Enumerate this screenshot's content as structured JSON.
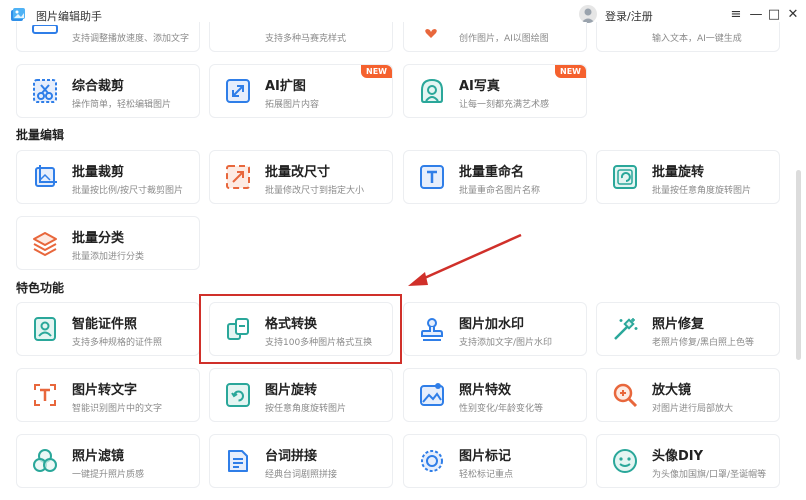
{
  "titlebar": {
    "app_title": "图片编辑助手",
    "login_label": "登录/注册",
    "menu_glyph": "≡",
    "min_glyph": "—",
    "max_glyph": "□",
    "close_glyph": "✕"
  },
  "cards_top": [
    {
      "desc": "支持调整播放速度、添加文字"
    },
    {
      "desc": "支持多种马赛克样式"
    },
    {
      "desc": "创作图片，AI以图绘图"
    },
    {
      "desc": "输入文本，AI一键生成"
    }
  ],
  "cards_row2": [
    {
      "title": "综合裁剪",
      "desc": "操作简单，轻松编辑图片",
      "icon": "crop-icon"
    },
    {
      "title": "AI扩图",
      "desc": "拓展图片内容",
      "icon": "expand-icon",
      "badge": "NEW"
    },
    {
      "title": "AI写真",
      "desc": "让每一刻都充满艺术感",
      "icon": "portrait-icon",
      "badge": "NEW"
    }
  ],
  "sections": {
    "batch": "批量编辑",
    "features": "特色功能"
  },
  "batch_cards": [
    {
      "title": "批量裁剪",
      "desc": "批量按比例/按尺寸裁剪图片",
      "icon": "batch-crop-icon"
    },
    {
      "title": "批量改尺寸",
      "desc": "批量修改尺寸到指定大小",
      "icon": "batch-resize-icon"
    },
    {
      "title": "批量重命名",
      "desc": "批量重命名图片名称",
      "icon": "batch-rename-icon"
    },
    {
      "title": "批量旋转",
      "desc": "批量按任意角度旋转图片",
      "icon": "batch-rotate-icon"
    },
    {
      "title": "批量分类",
      "desc": "批量添加进行分类",
      "icon": "layers-icon"
    }
  ],
  "feature_cards": [
    {
      "title": "智能证件照",
      "desc": "支持多种规格的证件照",
      "icon": "id-photo-icon"
    },
    {
      "title": "格式转换",
      "desc": "支持100多种图片格式互换",
      "icon": "format-convert-icon"
    },
    {
      "title": "图片加水印",
      "desc": "支持添加文字/图片水印",
      "icon": "stamp-icon"
    },
    {
      "title": "照片修复",
      "desc": "老照片修复/黑白照上色等",
      "icon": "magic-wand-icon"
    },
    {
      "title": "图片转文字",
      "desc": "智能识别图片中的文字",
      "icon": "text-recognition-icon"
    },
    {
      "title": "图片旋转",
      "desc": "按任意角度旋转图片",
      "icon": "rotate-icon"
    },
    {
      "title": "照片特效",
      "desc": "性别变化/年龄变化等",
      "icon": "image-effect-icon"
    },
    {
      "title": "放大镜",
      "desc": "对图片进行局部放大",
      "icon": "magnifier-icon"
    },
    {
      "title": "照片滤镜",
      "desc": "一键提升照片质感",
      "icon": "filter-icon"
    },
    {
      "title": "台词拼接",
      "desc": "经典台词剧照拼接",
      "icon": "document-icon"
    },
    {
      "title": "图片标记",
      "desc": "轻松标记重点",
      "icon": "mark-icon"
    },
    {
      "title": "头像DIY",
      "desc": "为头像加国旗/口罩/圣诞帽等",
      "icon": "face-icon"
    }
  ],
  "colors": {
    "accent_teal": "#2aa79a",
    "accent_blue": "#2f7ee8",
    "accent_orange": "#e8673c",
    "badge": "#f5612e",
    "annotation_red": "#d0302a"
  }
}
